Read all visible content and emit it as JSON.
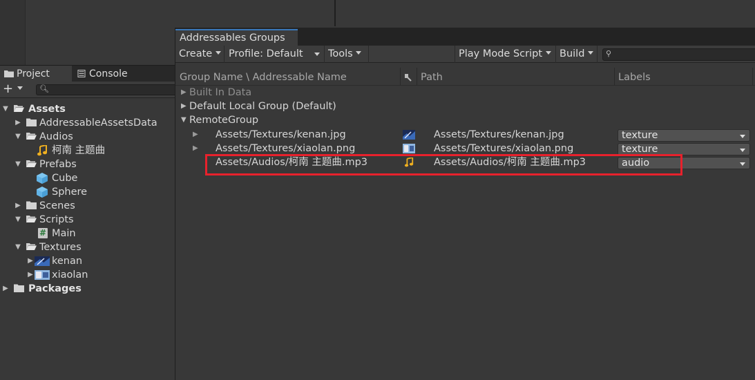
{
  "project_panel": {
    "tabs": [
      {
        "label": "Project",
        "icon": "folder-icon"
      },
      {
        "label": "Console",
        "icon": "console-icon"
      }
    ],
    "toolbar": {
      "add_label": "+",
      "search_placeholder": ""
    },
    "tree": [
      {
        "label": "Assets",
        "icon": "folder-open-icon",
        "expanded": true,
        "bold": true
      },
      {
        "label": "AddressableAssetsData",
        "icon": "folder-icon",
        "expanded": false
      },
      {
        "label": "Audios",
        "icon": "folder-open-icon",
        "expanded": true
      },
      {
        "label": "柯南 主题曲",
        "icon": "audio-clip-icon"
      },
      {
        "label": "Prefabs",
        "icon": "folder-open-icon",
        "expanded": true
      },
      {
        "label": "Cube",
        "icon": "prefab-cube-icon"
      },
      {
        "label": "Sphere",
        "icon": "prefab-cube-icon"
      },
      {
        "label": "Scenes",
        "icon": "folder-icon",
        "expanded": false
      },
      {
        "label": "Scripts",
        "icon": "folder-open-icon",
        "expanded": true
      },
      {
        "label": "Main",
        "icon": "csharp-script-icon"
      },
      {
        "label": "Textures",
        "icon": "folder-open-icon",
        "expanded": true
      },
      {
        "label": "kenan",
        "icon": "texture-thumbnail-icon"
      },
      {
        "label": "xiaolan",
        "icon": "texture-thumbnail-icon"
      },
      {
        "label": "Packages",
        "icon": "folder-icon",
        "expanded": false,
        "bold": true
      }
    ]
  },
  "addressables": {
    "window_title": "Addressables Groups",
    "toolbar": {
      "create": "Create",
      "profile": "Profile: Default",
      "tools": "Tools",
      "play_mode": "Play Mode Script",
      "build": "Build",
      "search_placeholder": ""
    },
    "columns": {
      "name": "Group Name \\ Addressable Name",
      "path": "Path",
      "labels": "Labels"
    },
    "groups": [
      {
        "name": "Built In Data",
        "dim": true
      },
      {
        "name": "Default Local Group (Default)"
      },
      {
        "name": "RemoteGroup",
        "expanded": true
      }
    ],
    "entries": [
      {
        "name": "Assets/Textures/kenan.jpg",
        "path": "Assets/Textures/kenan.jpg",
        "label": "texture",
        "icon": "texture-thumbnail-icon"
      },
      {
        "name": "Assets/Textures/xiaolan.png",
        "path": "Assets/Textures/xiaolan.png",
        "label": "texture",
        "icon": "texture-thumbnail-icon"
      },
      {
        "name": "Assets/Audios/柯南 主题曲.mp3",
        "path": "Assets/Audios/柯南 主题曲.mp3",
        "label": "audio",
        "icon": "audio-clip-icon"
      }
    ],
    "highlight_color": "#e8212c",
    "accent_color": "#3a79bb"
  }
}
